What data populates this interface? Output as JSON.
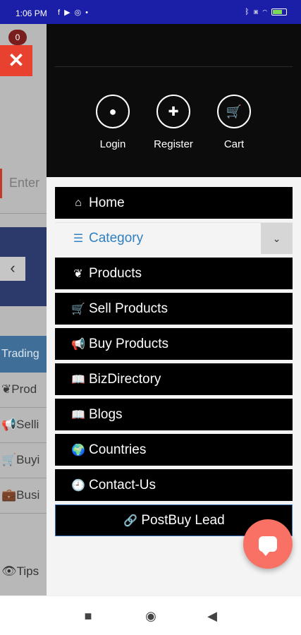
{
  "status_bar": {
    "time": "1:06 PM",
    "left_icons": [
      "facebook-icon",
      "play-icon",
      "whatsapp-icon",
      "dot-icon"
    ],
    "right_icons": [
      "bluetooth-icon",
      "signal-icon",
      "wifi-icon",
      "battery-icon"
    ],
    "background_color": "#1b1fa8"
  },
  "background_page": {
    "badge": "0",
    "close_glyph": "✕",
    "search_placeholder": "Enter",
    "banner_arrow": "‹",
    "trading_label": "Trading",
    "rows": [
      {
        "icon": "leaf-icon",
        "glyph": "❦",
        "label": "Prod"
      },
      {
        "icon": "megaphone-icon",
        "glyph": "📢",
        "label": "Selli"
      },
      {
        "icon": "cart-icon",
        "glyph": "🛒",
        "label": "Buyi"
      },
      {
        "icon": "briefcase-icon",
        "glyph": "💼",
        "label": "Busi"
      }
    ],
    "tips_label": "Tips",
    "tips_glyph": "👁"
  },
  "drawer": {
    "account_links": [
      {
        "label": "Login",
        "icon": "user-icon",
        "glyph": "●"
      },
      {
        "label": "Register",
        "icon": "user-plus-icon",
        "glyph": "✚"
      },
      {
        "label": "Cart",
        "icon": "cart-icon",
        "glyph": "🛒"
      }
    ],
    "menu": [
      {
        "label": "Home",
        "icon": "home-icon",
        "glyph": "⌂"
      },
      {
        "label": "Category",
        "icon": "list-icon",
        "glyph": "☰",
        "chevron": "⌄"
      },
      {
        "label": "Products",
        "icon": "leaf-icon",
        "glyph": "❦"
      },
      {
        "label": "Sell Products",
        "icon": "cart-icon",
        "glyph": "🛒"
      },
      {
        "label": "Buy Products",
        "icon": "megaphone-icon",
        "glyph": "📢"
      },
      {
        "label": "BizDirectory",
        "icon": "book-icon",
        "glyph": "📖"
      },
      {
        "label": "Blogs",
        "icon": "book-icon",
        "glyph": "📖"
      },
      {
        "label": "Countries",
        "icon": "globe-icon",
        "glyph": "🌍"
      },
      {
        "label": "Contact-Us",
        "icon": "clock-icon",
        "glyph": "🕘"
      },
      {
        "label": "PostBuy Lead",
        "icon": "link-icon",
        "glyph": "🔗"
      }
    ],
    "accent_color": "#2f7fc1",
    "fab_color": "#f97164"
  },
  "nav_bar": {
    "recents": "■",
    "home": "◉",
    "back": "◀"
  }
}
